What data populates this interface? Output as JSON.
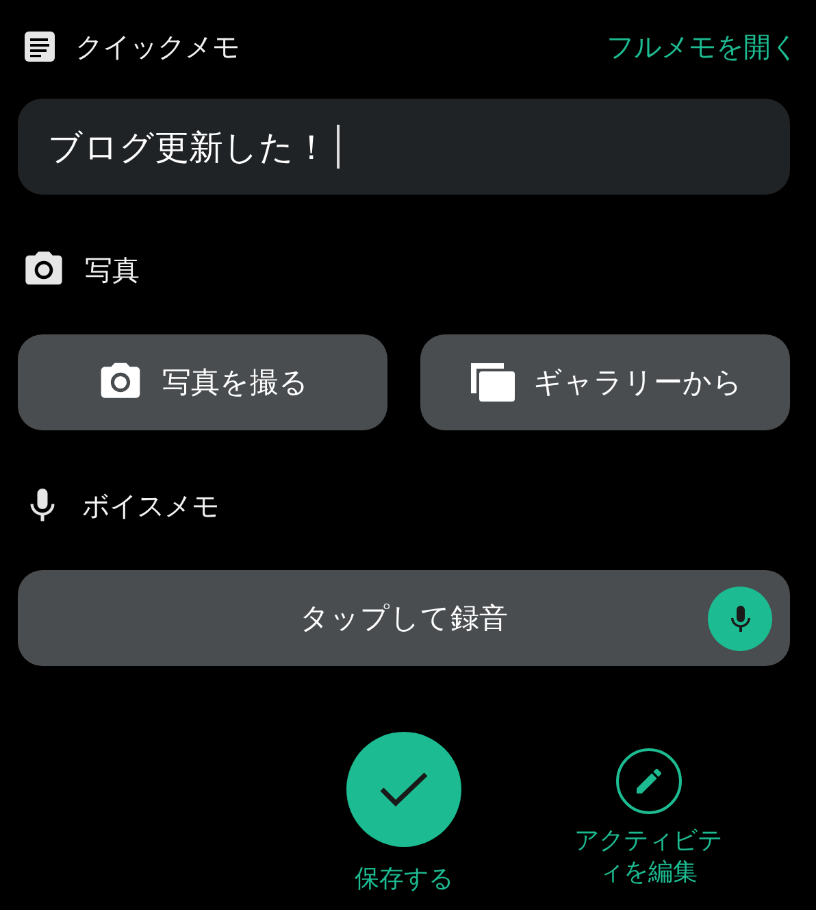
{
  "header": {
    "title": "クイックメモ",
    "link": "フルメモを開く"
  },
  "memo": {
    "value": "ブログ更新した！",
    "focused": true
  },
  "photo": {
    "title": "写真",
    "buttons": [
      {
        "kind": "camera",
        "label": "写真を撮る"
      },
      {
        "kind": "gallery",
        "label": "ギャラリーから"
      }
    ]
  },
  "voice": {
    "title": "ボイスメモ",
    "record": {
      "label": "タップして録音"
    }
  },
  "actions": [
    {
      "kind": "save",
      "label": "保存する"
    },
    {
      "kind": "edit",
      "label": "アクティビティを編集"
    }
  ]
}
